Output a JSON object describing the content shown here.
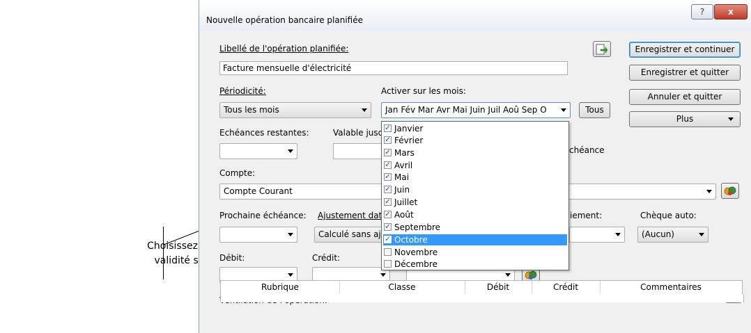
{
  "callout": {
    "line1": "Choisissez les mois de",
    "line2": "validité si nécessaire"
  },
  "window": {
    "title": "Nouvelle opération bancaire planifiée",
    "help_glyph": "?",
    "close_glyph": "x"
  },
  "form": {
    "libelle_label": "Libellé de l'opération planifiée:",
    "libelle_value": "Facture mensuelle d'électricité",
    "periodicite_label": "Périodicité:",
    "periodicite_value": "Tous les mois",
    "activer_label": "Activer sur les mois:",
    "activer_value": "Jan Fév Mar Avr Mai Juin Juil Aoû Sep O",
    "tous_label": "Tous",
    "echeances_label": "Echéances restantes:",
    "valable_label": "Valable jusq",
    "echeance_partial": "chéance",
    "compte_label": "Compte:",
    "compte_value": "Compte Courant",
    "prochaine_label": "Prochaine échéance:",
    "ajustement_label": "Ajustement dat",
    "ajustement_value": "Calculé sans aj",
    "paiement_partial": "iement:",
    "cheque_label": "Chèque auto:",
    "cheque_value": "(Aucun)",
    "debit_label": "Débit:",
    "credit_label": "Crédit:",
    "ventilation_label": "Ventilation de l'opération:"
  },
  "buttons": {
    "enregistrer_continuer": "Enregistrer et continuer",
    "enregistrer_quitter": "Enregistrer et quitter",
    "annuler_quitter": "Annuler et quitter",
    "plus": "Plus"
  },
  "months": [
    {
      "label": "Janvier",
      "checked": true,
      "selected": false
    },
    {
      "label": "Février",
      "checked": true,
      "selected": false
    },
    {
      "label": "Mars",
      "checked": true,
      "selected": false
    },
    {
      "label": "Avril",
      "checked": true,
      "selected": false
    },
    {
      "label": "Mai",
      "checked": true,
      "selected": false
    },
    {
      "label": "Juin",
      "checked": true,
      "selected": false
    },
    {
      "label": "Juillet",
      "checked": true,
      "selected": false
    },
    {
      "label": "Août",
      "checked": true,
      "selected": false
    },
    {
      "label": "Septembre",
      "checked": true,
      "selected": false
    },
    {
      "label": "Octobre",
      "checked": true,
      "selected": true
    },
    {
      "label": "Novembre",
      "checked": false,
      "selected": false
    },
    {
      "label": "Décembre",
      "checked": false,
      "selected": false
    }
  ],
  "table": {
    "columns": [
      "Rubrique",
      "Classe",
      "Débit",
      "Crédit",
      "Commentaires"
    ]
  },
  "icons": {
    "export": "export-icon",
    "accounts": "accounts-icon",
    "delete": "delete-icon"
  },
  "colors": {
    "selection": "#3399ff",
    "window_bg": "#f0f0f0",
    "close_red": "#c23d2a"
  }
}
